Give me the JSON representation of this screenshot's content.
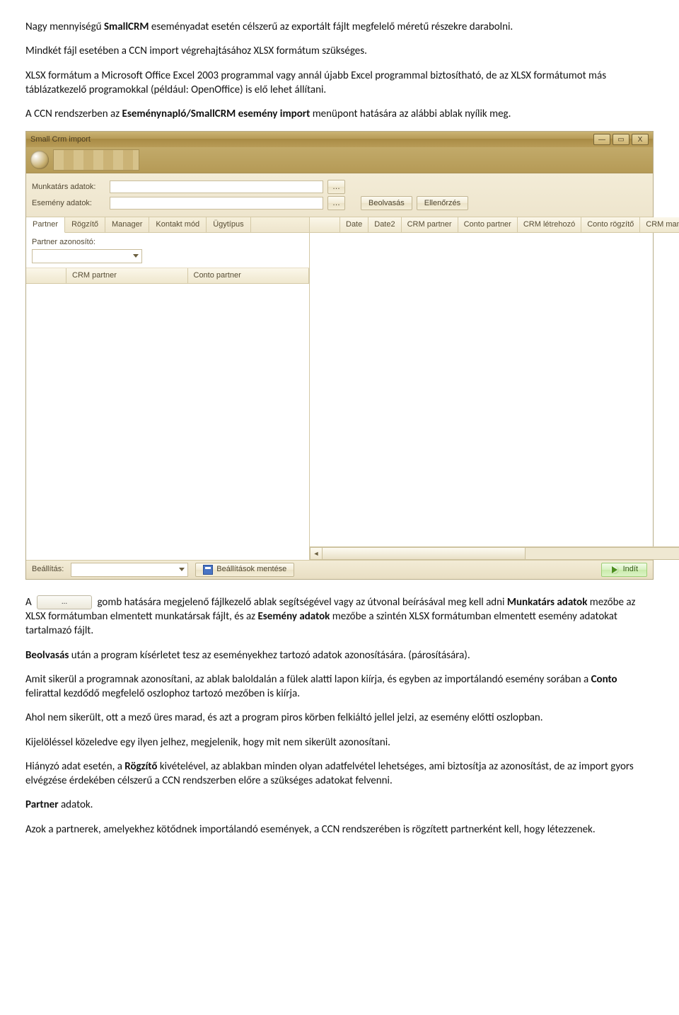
{
  "doc": {
    "p1a": "Nagy mennyiségű ",
    "p1b": "SmallCRM",
    "p1c": " eseményadat esetén célszerű az exportált fájlt megfelelő méretű részekre darabolni.",
    "p2": "Mindkét fájl esetében a CCN import végrehajtásához XLSX formátum szükséges.",
    "p3": "XLSX formátum a Microsoft Office Excel 2003 programmal vagy annál újabb Excel programmal biztosítható, de az XLSX formátumot más táblázatkezelő programokkal (például: OpenOffice) is elő lehet állítani.",
    "p4a": "A CCN rendszerben az ",
    "p4b": "Eseménynapló/SmallCRM esemény import",
    "p4c": " menüpont hatására az alábbi ablak nyílik meg.",
    "p5a": "A ",
    "p5btn": "…",
    "p5b": " gomb hatására megjelenő fájlkezelő ablak segítségével vagy az útvonal beírásával meg kell adni ",
    "p5c": "Munkatárs adatok",
    "p5d": " mezőbe az XLSX formátumban elmentett munkatársak fájlt, és az ",
    "p5e": "Esemény adatok",
    "p5f": " mezőbe a szintén XLSX formátumban elmentett esemény adatokat tartalmazó fájlt.",
    "p6a": "Beolvasás",
    "p6b": " után a program kísérletet tesz az eseményekhez tartozó adatok azonosítására. (párosítására).",
    "p7a": "Amit sikerül a programnak azonosítani, az ablak baloldalán a fülek alatti lapon kiírja, és egyben az importálandó esemény sorában a ",
    "p7b": "Conto",
    "p7c": " felirattal kezdődő megfelelő oszlophoz tartozó mezőben is kiírja.",
    "p8": "Ahol nem sikerült, ott a mező üres marad, és azt a program piros körben felkiáltó jellel jelzi, az esemény előtti oszlopban.",
    "p9": "Kijelöléssel közeledve egy ilyen jelhez, megjelenik, hogy mit nem sikerült azonosítani.",
    "p10a": "Hiányzó adat esetén, a ",
    "p10b": "Rögzítő",
    "p10c": " kivételével, az ablakban minden olyan adatfelvétel lehetséges, ami biztosítja az azonosítást, de az import gyors elvégzése érdekében célszerű a CCN rendszerben előre a szükséges adatokat felvenni.",
    "p11a": "Partner",
    "p11b": " adatok.",
    "p12": "Azok a partnerek, amelyekhez kötődnek importálandó események, a CCN rendszerében is rögzített partnerként kell, hogy létezzenek."
  },
  "win": {
    "title": "Small Crm import",
    "btn_min": "—",
    "btn_max": "▭",
    "btn_close": "X",
    "lbl_munkatars": "Munkatárs adatok:",
    "lbl_esemeny": "Esemény adatok:",
    "btn_dots": "…",
    "btn_beolvasas": "Beolvasás",
    "btn_ellenorzes": "Ellenőrzés",
    "tabs": [
      "Partner",
      "Rögzítő",
      "Manager",
      "Kontakt mód",
      "Ügytípus"
    ],
    "lbl_azon": "Partner azonosító:",
    "left_cols": [
      "CRM partner",
      "Conto partner"
    ],
    "right_cols": [
      "Date",
      "Date2",
      "CRM partner",
      "Conto partner",
      "CRM létrehozó",
      "Conto rögzítő",
      "CRM manager"
    ],
    "lbl_beallitas": "Beállítás:",
    "btn_save": "Beállítások mentése",
    "btn_run": "Indít"
  }
}
